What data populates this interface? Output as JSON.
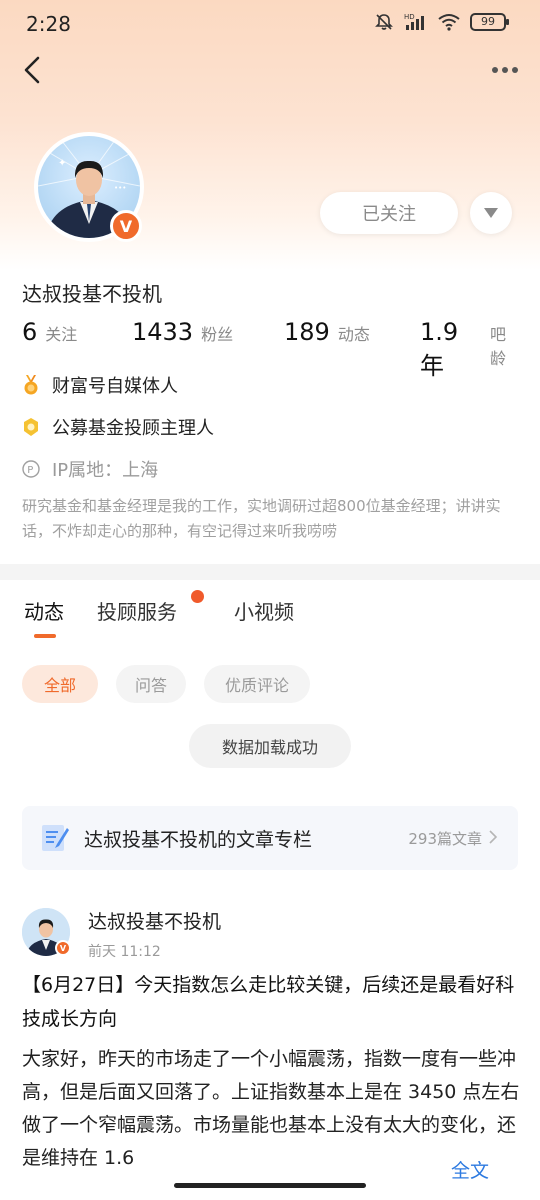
{
  "status_bar": {
    "time": "2:28",
    "battery": "99"
  },
  "profile": {
    "follow_label": "已关注",
    "name": "达叔投基不投机",
    "stats": [
      {
        "value": "6",
        "label": "关注"
      },
      {
        "value": "1433",
        "label": "粉丝"
      },
      {
        "value": "189",
        "label": "动态"
      },
      {
        "value": "1.9年",
        "label": "吧龄"
      }
    ],
    "tags": [
      {
        "icon": "medal-icon",
        "text": "财富号自媒体人"
      },
      {
        "icon": "badge-icon",
        "text": "公募基金投顾主理人"
      }
    ],
    "ip_location": "IP属地：上海",
    "bio": "研究基金和基金经理是我的工作，实地调研过超800位基金经理；讲讲实话，不炸却走心的那种，有空记得过来听我唠唠"
  },
  "tabs": [
    {
      "label": "动态",
      "active": true
    },
    {
      "label": "投顾服务",
      "active": false,
      "has_dot": true
    },
    {
      "label": "小视频",
      "active": false
    }
  ],
  "filter_chips": [
    {
      "label": "全部",
      "active": true
    },
    {
      "label": "问答",
      "active": false
    },
    {
      "label": "优质评论",
      "active": false
    }
  ],
  "toast": "数据加载成功",
  "column": {
    "title": "达叔投基不投机的文章专栏",
    "count": "293篇文章"
  },
  "post": {
    "author": "达叔投基不投机",
    "time": "前天 11:12",
    "title": "【6月27日】今天指数怎么走比较关键，后续还是最看好科技成长方向",
    "body": "大家好，昨天的市场走了一个小幅震荡，指数一度有一些冲高，但是后面又回落了。上证指数基本上是在 3450 点左右做了一个窄幅震荡。市场量能也基本上没有太大的变化，还是维持在 1.6",
    "full_text_label": "全文"
  },
  "colors": {
    "accent": "#f06a2b",
    "link": "#2d7ae0"
  }
}
